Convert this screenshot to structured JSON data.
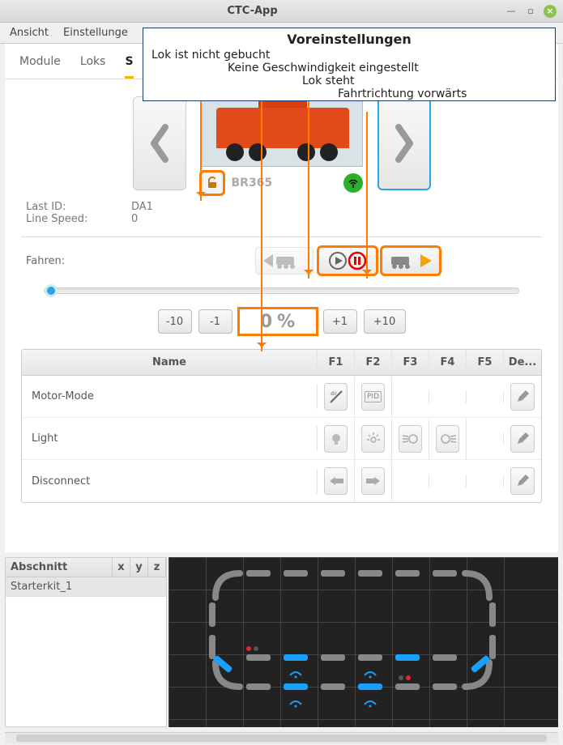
{
  "window": {
    "title": "CTC-App"
  },
  "menu": {
    "view": "Ansicht",
    "settings": "Einstellunge"
  },
  "tabs": {
    "t1": "Module",
    "t2": "Loks",
    "t3_initial": "S"
  },
  "overlay": {
    "title": "Voreinstellungen",
    "l1": "Lok ist nicht gebucht",
    "l2": "Keine Geschwindigkeit eingestellt",
    "l3": "Lok steht",
    "l4": "Fahrtrichtung vorwärts"
  },
  "loco": {
    "name": "BR365"
  },
  "info": {
    "last_id_k": "Last ID:",
    "last_id_v": "DA1",
    "line_speed_k": "Line Speed:",
    "line_speed_v": "0"
  },
  "drive": {
    "label": "Fahren:"
  },
  "speed": {
    "m10": "-10",
    "m1": "-1",
    "val": "0",
    "unit": "%",
    "p1": "+1",
    "p10": "+10"
  },
  "func_hdr": {
    "name": "Name",
    "f1": "F1",
    "f2": "F2",
    "f3": "F3",
    "f4": "F4",
    "f5": "F5",
    "de": "De..."
  },
  "func_rows": {
    "r1": "Motor-Mode",
    "r2": "Light",
    "r3": "Disconnect"
  },
  "sections": {
    "hdr_name": "Abschnitt",
    "hdr_x": "x",
    "hdr_y": "y",
    "hdr_z": "z",
    "row1": "Starterkit_1"
  }
}
